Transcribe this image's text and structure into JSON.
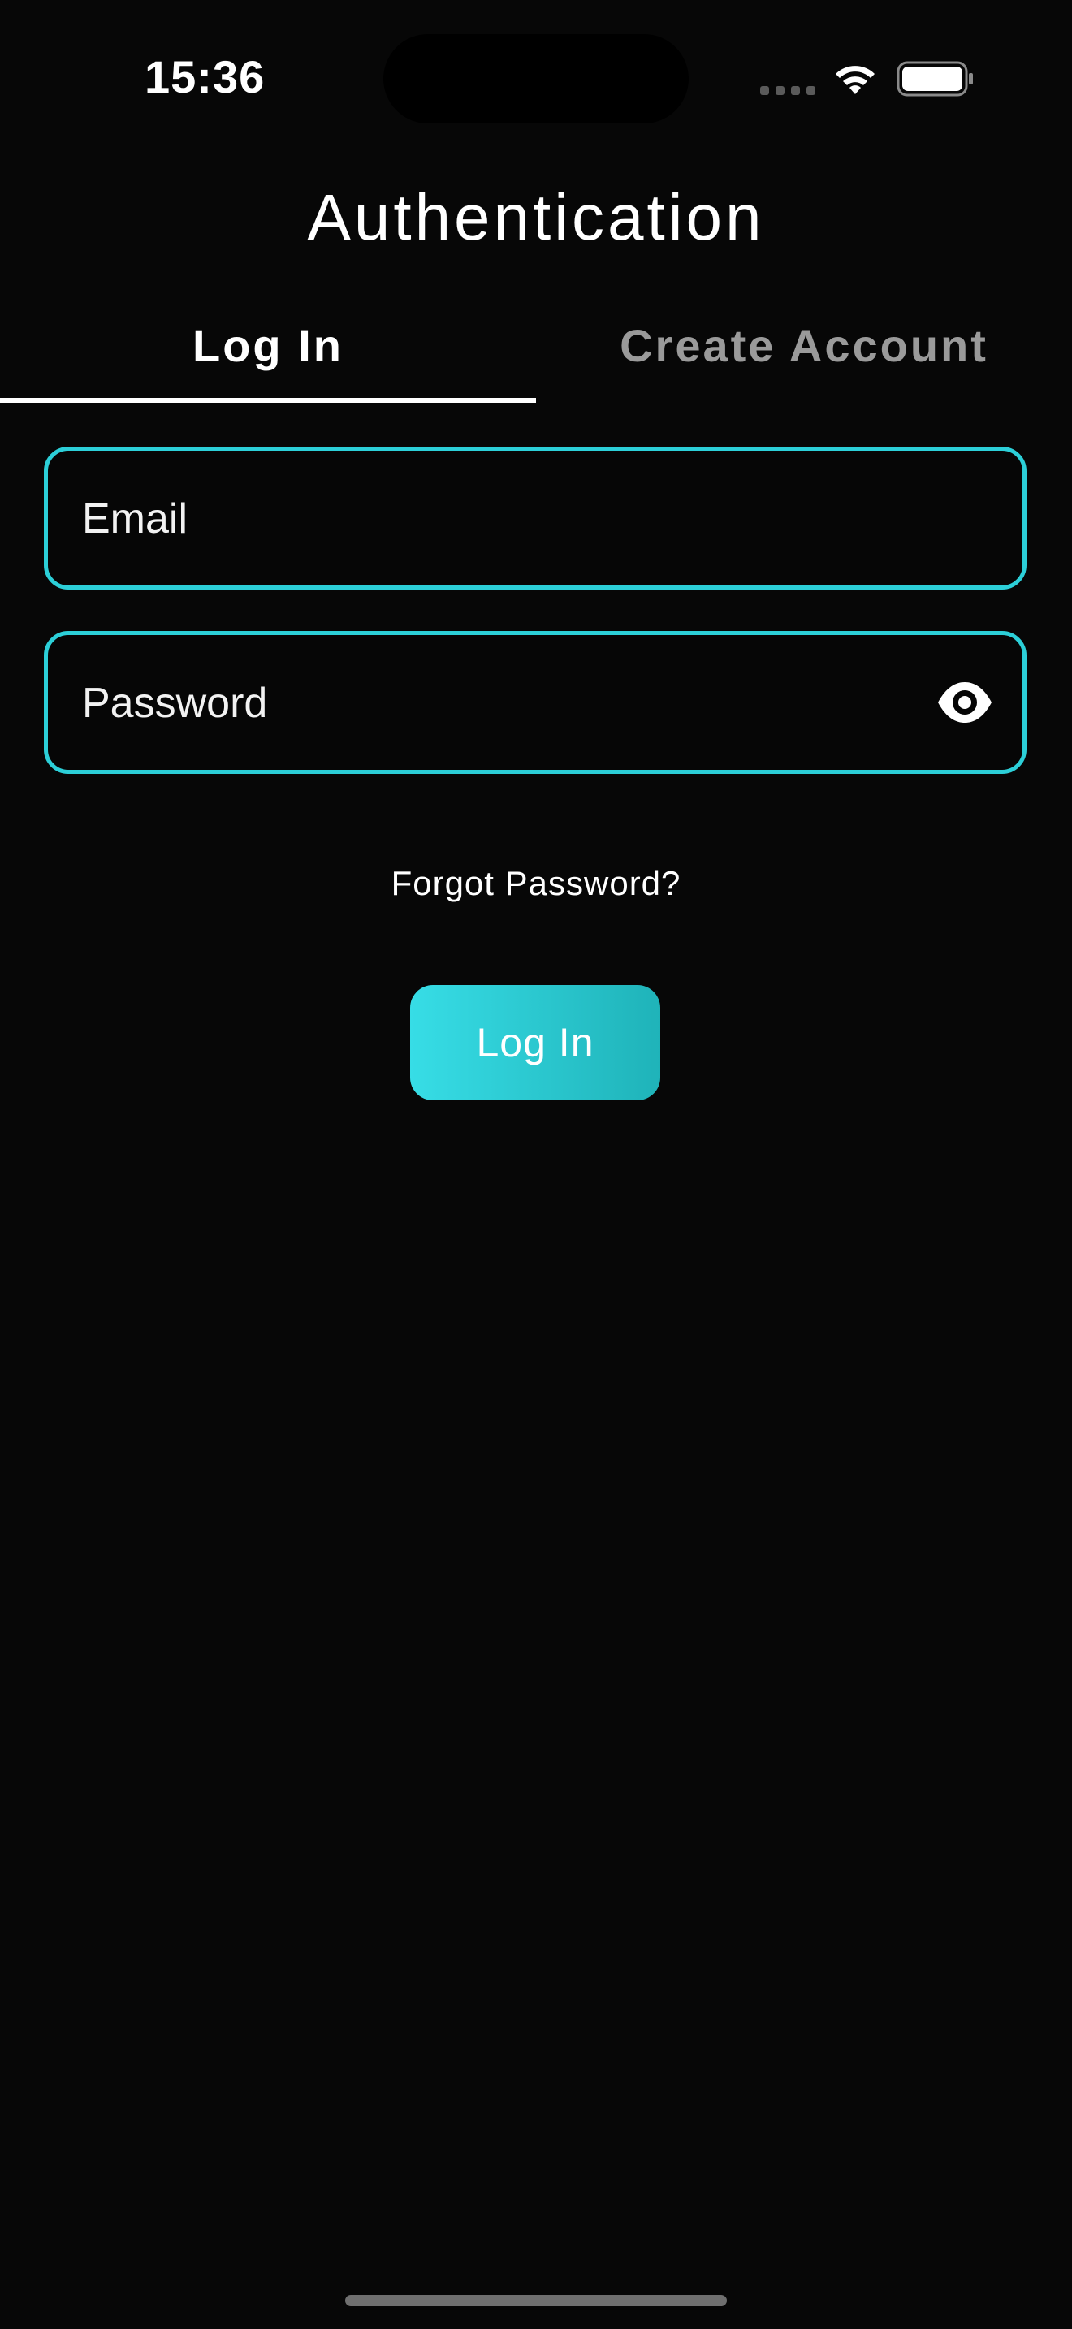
{
  "status_bar": {
    "time": "15:36"
  },
  "header": {
    "title": "Authentication"
  },
  "tabs": [
    {
      "label": "Log In",
      "selected": true
    },
    {
      "label": "Create Account",
      "selected": false
    }
  ],
  "form": {
    "email_placeholder": "Email",
    "email_value": "",
    "password_placeholder": "Password",
    "password_value": "",
    "forgot_label": "Forgot Password?",
    "submit_label": "Log In"
  },
  "colors": {
    "background": "#070707",
    "accent": "#2ccfd8",
    "tab_inactive": "#9a9a9a"
  },
  "icons": {
    "password_toggle": "eye-icon",
    "wifi": "wifi-icon",
    "battery": "battery-icon"
  }
}
